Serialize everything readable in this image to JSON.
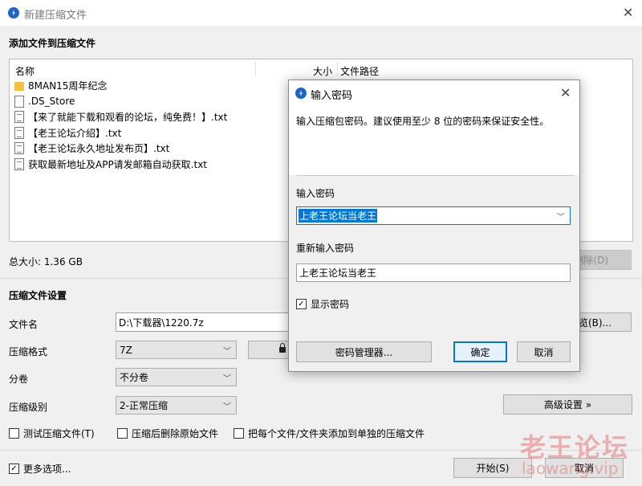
{
  "window": {
    "title": "新建压缩文件",
    "close_glyph": "✕"
  },
  "add_section": {
    "heading": "添加文件到压缩文件",
    "columns": {
      "name": "名称",
      "size": "大小",
      "path": "文件路径"
    },
    "files": [
      {
        "name": "8MAN15周年纪念",
        "icon": "folder-icon"
      },
      {
        "name": ".DS_Store",
        "icon": "file-icon"
      },
      {
        "name": "【来了就能下载和观看的论坛，纯免费！】.txt",
        "icon": "text-file-icon"
      },
      {
        "name": "【老王论坛介绍】.txt",
        "icon": "text-file-icon"
      },
      {
        "name": "【老王论坛永久地址发布页】.txt",
        "icon": "text-file-icon"
      },
      {
        "name": "获取最新地址及APP请发邮箱自动获取.txt",
        "icon": "text-file-icon"
      }
    ],
    "total_size": "总大小: 1.36 GB",
    "delete_label": "删除(D)"
  },
  "settings": {
    "heading": "压缩文件设置",
    "filename_label": "文件名",
    "filename_value": "D:\\下载器\\1220.7z",
    "browse_label": "浏览(B)...",
    "format_label": "压缩格式",
    "format_value": "7Z",
    "lock_glyph": "🔒",
    "split_label": "分卷",
    "split_value": "不分卷",
    "level_label": "压缩级别",
    "level_value": "2-正常压缩",
    "advanced_label": "高级设置 »",
    "opt_test": "测试压缩文件(T)",
    "opt_delete": "压缩后删除原始文件",
    "opt_each": "把每个文件/文件夹添加到单独的压缩文件",
    "more_options": "更多选项...",
    "start_label": "开始(S)",
    "cancel_label": "取消"
  },
  "password_dialog": {
    "title": "输入密码",
    "close_glyph": "✕",
    "description": "输入压缩包密码。建议使用至少 8 位的密码来保证安全性。",
    "password_label": "输入密码",
    "password_value": "上老王论坛当老王",
    "confirm_label": "重新输入密码",
    "confirm_value": "上老王论坛当老王",
    "show_password_label": "显示密码",
    "show_password_checked": true,
    "manager_label": "密码管理器...",
    "ok_label": "确定",
    "cancel_label": "取消"
  },
  "watermark": {
    "line1": "老王论坛",
    "line2": "laowang.vip"
  },
  "colors": {
    "accent": "#0078d7",
    "app_icon": "#1e63c6",
    "watermark": "#e67878"
  }
}
